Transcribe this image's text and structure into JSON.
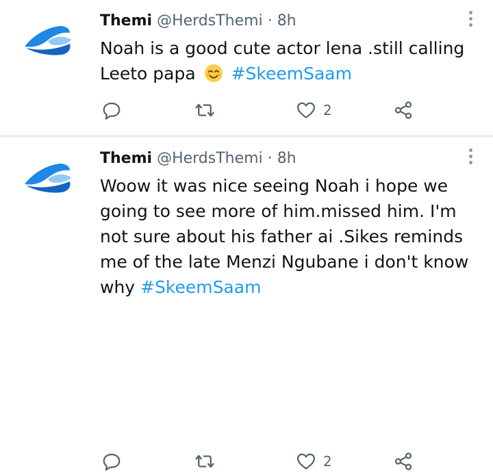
{
  "tweets": [
    {
      "name": "Themi",
      "handle": "@HerdsThemi",
      "separator": "·",
      "time": "8h",
      "text_before": "Noah  is a good cute  actor lena .still calling Leeto papa",
      "emoji": "smiling-face-emoji",
      "hashtag": "#SkeemSaam",
      "text_after": "",
      "like_count": "2"
    },
    {
      "name": "Themi",
      "handle": "@HerdsThemi",
      "separator": "·",
      "time": "8h",
      "text_before": "Woow it was nice seeing Noah i hope we going to see more of him.missed him.  I'm not sure about his father ai .Sikes reminds me of the late Menzi Ngubane i don't know why",
      "hashtag": "#SkeemSaam",
      "text_after": "",
      "like_count": "2"
    }
  ],
  "colors": {
    "hashtag": "#1d9bf0",
    "secondary_text": "#536471",
    "avatar_blue": "#1e88e5"
  },
  "icons": [
    "reply-icon",
    "retweet-icon",
    "like-icon",
    "share-icon",
    "more-options-icon"
  ]
}
